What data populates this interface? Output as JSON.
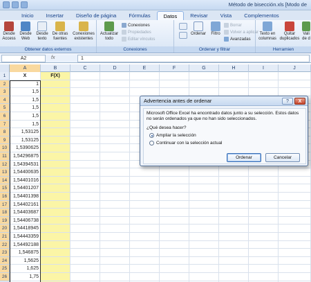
{
  "window": {
    "title": "Método de bisección.xls  [Modo de"
  },
  "ribbon_tabs": [
    "Inicio",
    "Insertar",
    "Diseño de página",
    "Fórmulas",
    "Datos",
    "Revisar",
    "Vista",
    "Complementos"
  ],
  "active_tab": "Datos",
  "ribbon": {
    "external": {
      "label": "Obtener datos externos",
      "access": "Desde Access",
      "web": "Desde Web",
      "text": "Desde texto",
      "other": "De otras fuentes",
      "existing": "Conexiones existentes"
    },
    "connections": {
      "label": "Conexiones",
      "refresh": "Actualizar todo",
      "connections": "Conexiones",
      "properties": "Propiedades",
      "edit_links": "Editar vínculos"
    },
    "sort_filter": {
      "label": "Ordenar y filtrar",
      "sort": "Ordenar",
      "filter": "Filtro",
      "clear": "Borrar",
      "reapply": "Volver a aplicar",
      "advanced": "Avanzadas"
    },
    "tools": {
      "label": "Herramien",
      "text_to_columns": "Texto en columnas",
      "remove_duplicates": "Quitar duplicados",
      "validation": "Vali de d"
    }
  },
  "formula_bar": {
    "name_box": "A2",
    "fx": "fx",
    "value": "1"
  },
  "columns": [
    "A",
    "B",
    "C",
    "D",
    "E",
    "F",
    "G",
    "H",
    "I",
    "J"
  ],
  "row_numbers": [
    "1",
    "2",
    "3",
    "4",
    "5",
    "6",
    "7",
    "8",
    "9",
    "10",
    "11",
    "12",
    "13",
    "14",
    "15",
    "16",
    "17",
    "18",
    "19",
    "20",
    "21",
    "22",
    "23",
    "24",
    "25",
    "26",
    "27"
  ],
  "header_row": {
    "a": "X",
    "b": "F(X)"
  },
  "x_values": [
    "1",
    "1,5",
    "1,5",
    "1,5",
    "1,5",
    "1,5",
    "1,53125",
    "1,53125",
    "1,5390625",
    "1,54296875",
    "1,54394531",
    "1,54400635",
    "1,54401016",
    "1,54401207",
    "1,54401398",
    "1,54402161",
    "1,54403687",
    "1,54406738",
    "1,54418945",
    "1,54443359",
    "1,54492188",
    "1,546875",
    "1,5625",
    "1,625",
    "1,75",
    "2"
  ],
  "dialog": {
    "title": "Advertencia antes de ordenar",
    "help": "?",
    "close": "X",
    "message": "Microsoft Office Excel ha encontrado datos junto a su selección. Estos datos no serán ordenados ya que no han sido seleccionados.",
    "question": "¿Qué desea hacer?",
    "options": [
      "Ampliar la selección",
      "Continuar con la selección actual"
    ],
    "selected_option": 0,
    "ok_button": "Ordenar",
    "cancel_button": "Cancelar"
  }
}
